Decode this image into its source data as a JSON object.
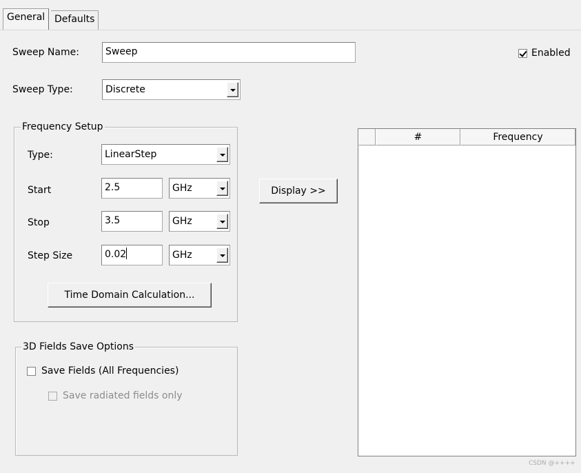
{
  "tabs": [
    {
      "label": "General",
      "active": true
    },
    {
      "label": "Defaults",
      "active": false
    }
  ],
  "sweep_name": {
    "label": "Sweep Name:",
    "value": "Sweep"
  },
  "enabled": {
    "label": "Enabled",
    "checked": true
  },
  "sweep_type": {
    "label": "Sweep Type:",
    "value": "Discrete"
  },
  "frequency_setup": {
    "title": "Frequency Setup",
    "type": {
      "label": "Type:",
      "value": "LinearStep"
    },
    "start": {
      "label": "Start",
      "value": "2.5",
      "unit": "GHz"
    },
    "stop": {
      "label": "Stop",
      "value": "3.5",
      "unit": "GHz"
    },
    "step_size": {
      "label": "Step Size",
      "value": "0.02",
      "unit": "GHz"
    },
    "time_domain_button": "Time Domain Calculation..."
  },
  "display_button": "Display >>",
  "frequency_table": {
    "columns": [
      "",
      "#",
      "Frequency"
    ],
    "rows": []
  },
  "fields_save_options": {
    "title": "3D Fields Save Options",
    "save_fields": {
      "label": "Save Fields (All Frequencies)",
      "checked": false
    },
    "save_radiated": {
      "label": "Save radiated fields only",
      "checked": false,
      "disabled": true
    }
  },
  "watermark": "CSDN @++++",
  "icons": {
    "dropdown": "chevron-down-icon",
    "checkmark": "checkmark-icon"
  },
  "colors": {
    "background": "#f0f0f0",
    "field": "#ffffff",
    "disabled_text": "#8c8c8c"
  }
}
